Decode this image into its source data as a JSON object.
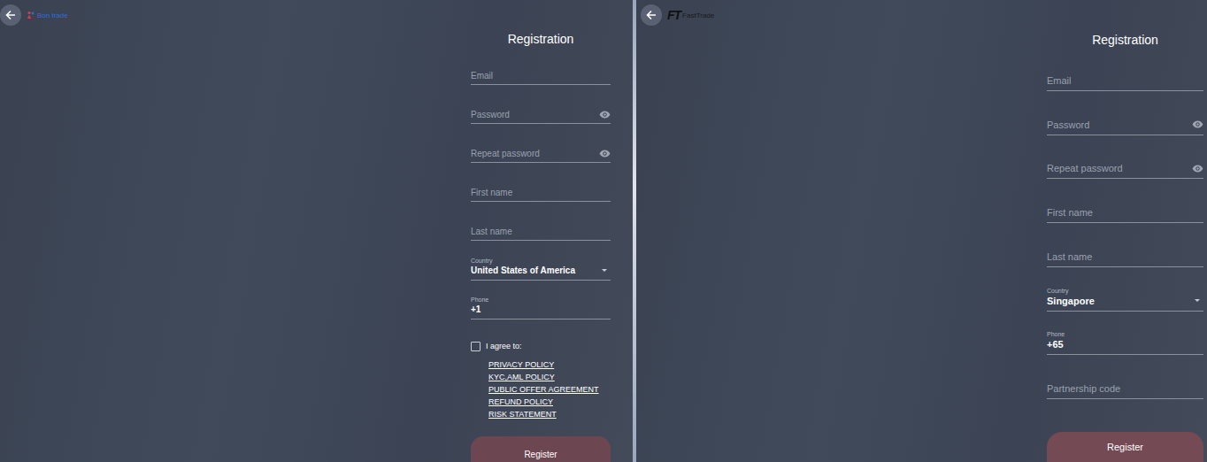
{
  "panels": [
    {
      "logo": {
        "kind": "icon",
        "text": "Bon trade"
      },
      "title": "Registration",
      "fields": [
        {
          "kind": "text",
          "label": "Email"
        },
        {
          "kind": "password",
          "label": "Password"
        },
        {
          "kind": "password",
          "label": "Repeat password"
        },
        {
          "kind": "text",
          "label": "First name"
        },
        {
          "kind": "text",
          "label": "Last name"
        },
        {
          "kind": "select",
          "label": "Country",
          "value": "United States of America"
        },
        {
          "kind": "phone",
          "label": "Phone",
          "value": "+1"
        }
      ],
      "agreement": {
        "label": "I agree to:",
        "checked": false,
        "links": [
          "PRIVACY POLICY",
          "KYC,AML POLICY",
          "PUBLIC OFFER AGREEMENT",
          "REFUND POLICY",
          "RISK STATEMENT"
        ]
      },
      "button": "Register"
    },
    {
      "logo": {
        "kind": "mark",
        "mark": "FT",
        "text": "FastTrade"
      },
      "title": "Registration",
      "fields": [
        {
          "kind": "text",
          "label": "Email"
        },
        {
          "kind": "password",
          "label": "Password"
        },
        {
          "kind": "password",
          "label": "Repeat password"
        },
        {
          "kind": "text",
          "label": "First name"
        },
        {
          "kind": "text",
          "label": "Last name"
        },
        {
          "kind": "select",
          "label": "Country",
          "value": "Singapore"
        },
        {
          "kind": "phone",
          "label": "Phone",
          "value": "+65"
        },
        {
          "kind": "text",
          "label": "Partnership code"
        }
      ],
      "button": "Register"
    }
  ]
}
